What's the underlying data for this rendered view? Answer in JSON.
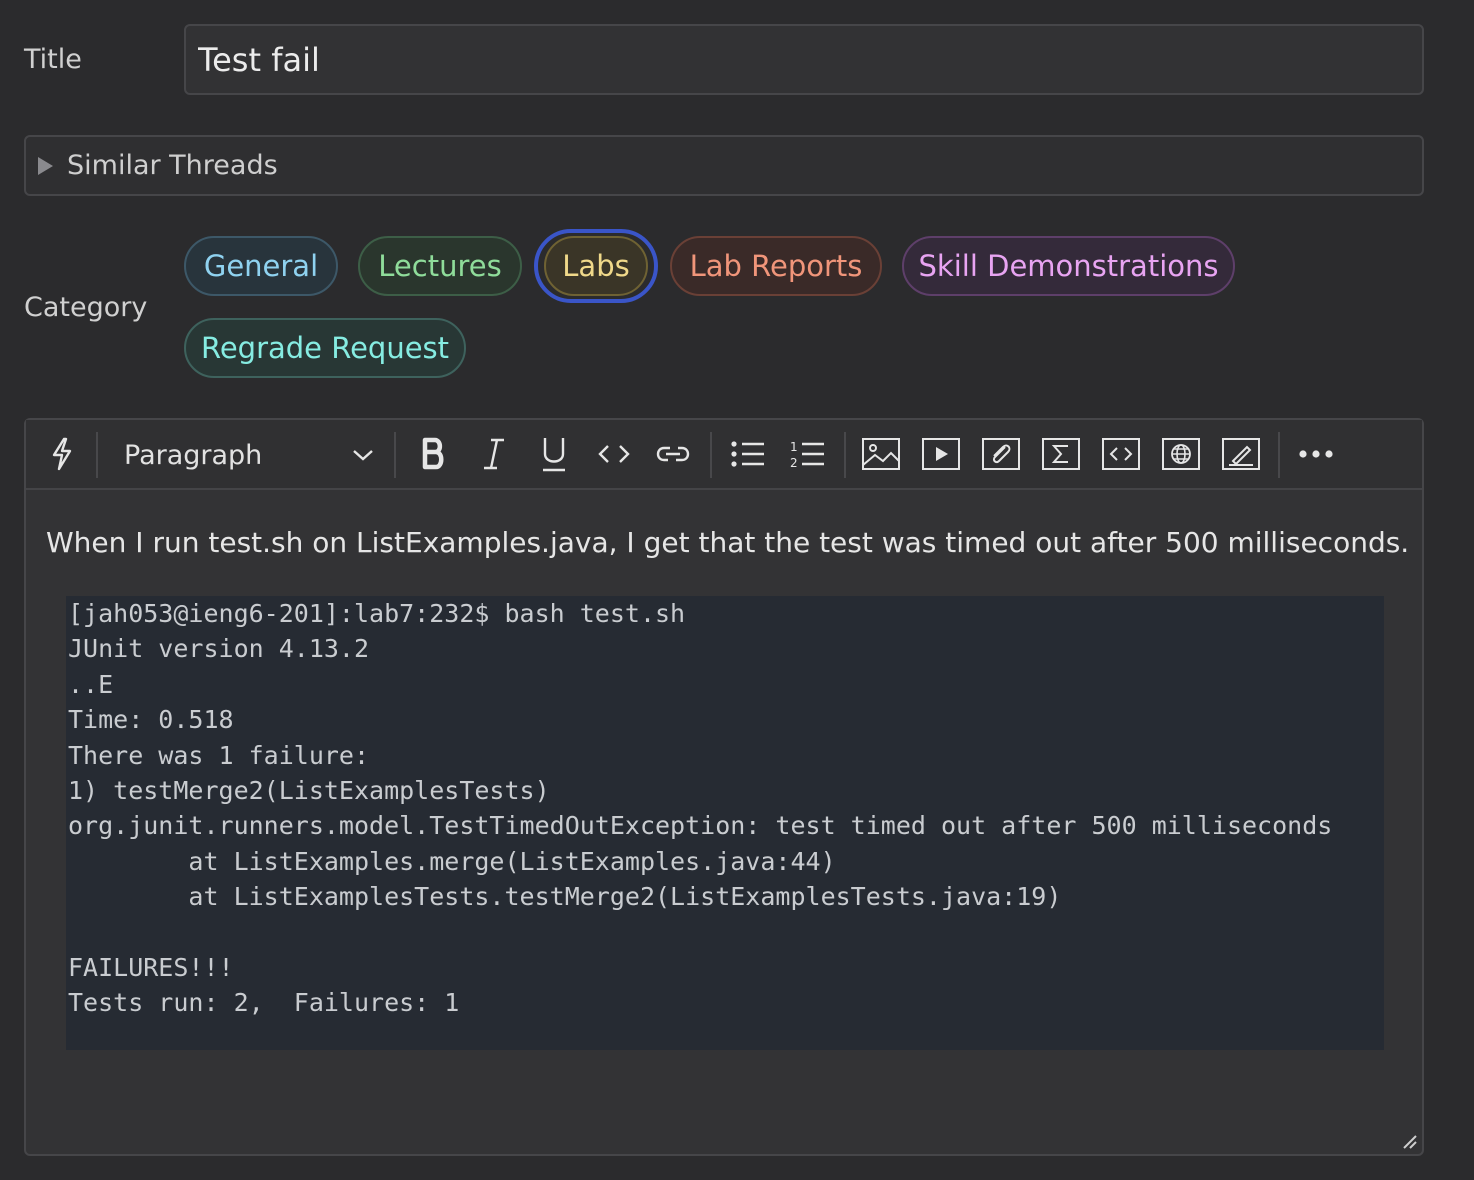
{
  "form": {
    "title_label": "Title",
    "title_value": "Test fail",
    "similar_threads_label": "Similar Threads",
    "category_label": "Category",
    "categories": [
      {
        "label": "General",
        "color": "#8fd2f0",
        "selected": false
      },
      {
        "label": "Lectures",
        "color": "#8fdc9a",
        "selected": false
      },
      {
        "label": "Labs",
        "color": "#f0d98a",
        "selected": true
      },
      {
        "label": "Lab Reports",
        "color": "#f0957a",
        "selected": false
      },
      {
        "label": "Skill Demonstrations",
        "color": "#e8a4f2",
        "selected": false
      },
      {
        "label": "Regrade Request",
        "color": "#86ece2",
        "selected": false
      }
    ]
  },
  "toolbar": {
    "paragraph_style": "Paragraph",
    "buttons": [
      "bolt-icon",
      "bold-icon",
      "italic-icon",
      "underline-icon",
      "inline-code-icon",
      "link-icon",
      "bullet-list-icon",
      "numbered-list-icon",
      "image-icon",
      "video-icon",
      "attachment-icon",
      "math-icon",
      "code-block-icon",
      "web-embed-icon",
      "drawing-icon",
      "more-icon"
    ]
  },
  "body": {
    "paragraph": "When I run test.sh on ListExamples.java, I get that the test was timed out after 500 milliseconds.",
    "code": "[jah053@ieng6-201]:lab7:232$ bash test.sh\nJUnit version 4.13.2\n..E\nTime: 0.518\nThere was 1 failure:\n1) testMerge2(ListExamplesTests)\norg.junit.runners.model.TestTimedOutException: test timed out after 500 milliseconds\n        at ListExamples.merge(ListExamples.java:44)\n        at ListExamplesTests.testMerge2(ListExamplesTests.java:19)\n\nFAILURES!!!\nTests run: 2,  Failures: 1"
  }
}
